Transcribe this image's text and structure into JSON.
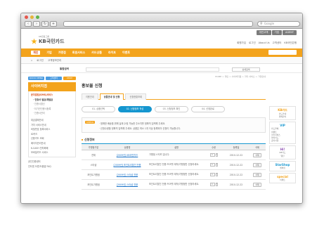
{
  "browser": {
    "search_placeholder": "Google"
  },
  "utility": [
    "개인고객",
    "기업",
    "AGENT"
  ],
  "logo": {
    "sub": "KB금융그룹",
    "name": "KB국민카드"
  },
  "toplinks": [
    "회원가입",
    "로그인",
    "About Us",
    "고객센터",
    "KB국민은행"
  ],
  "gnb": {
    "items": [
      "개인",
      "기업",
      "가맹점",
      "회원서비스",
      "카드상품",
      "라이프",
      "이벤트"
    ],
    "active_index": 0
  },
  "subnav": {
    "home_icon": "house-icon",
    "items": [
      "로그인",
      "고객정보관리"
    ]
  },
  "search_row": {
    "select": "통합검색",
    "button": "상세검색"
  },
  "quick": [
    "QUICK MENU",
    "고객센터",
    "CHAT"
  ],
  "lnb": {
    "title": "사이버지점",
    "items": [
      {
        "label": "문자알림(SMS)서비스",
        "level": 0,
        "on": true
      },
      {
        "label": "· 인증서 발급/재발급",
        "level": 1,
        "on": true
      },
      {
        "label": "· 인증서갱신",
        "level": 1,
        "on": false
      },
      {
        "label": "· 타기관인증서등록",
        "level": 1,
        "on": false
      },
      {
        "label": "· 인증서관리",
        "level": 1,
        "on": false
      },
      {
        "label": "",
        "level": -1,
        "on": false
      },
      {
        "label": "대금결제안내",
        "level": 0,
        "on": false
      },
      {
        "label": "가치 서비스안내",
        "level": 0,
        "on": false
      },
      {
        "label": "비밀번호 등록서비스",
        "level": 0,
        "on": false
      },
      {
        "label": "ID카드",
        "level": 0,
        "on": false
      },
      {
        "label": "신용카드 조회",
        "level": 0,
        "on": false
      },
      {
        "label": "페이지관리안내",
        "level": 0,
        "on": false
      },
      {
        "label": "K-CASH 전자화폐",
        "level": 0,
        "on": false
      },
      {
        "label": "모바일카드 서비스",
        "level": 0,
        "on": false
      }
    ],
    "footer": [
      "공인인증센터",
      "인터넷 오류/도움말 FAQ"
    ]
  },
  "breadcrumb": "HOME > 개인 > 사이버지점 > 기타 서비스 > 가입안내",
  "page_title": "홍보물 신청",
  "tabs": [
    "이용안내",
    "상품안내 및 신청",
    "신청현황조회"
  ],
  "active_tab": 1,
  "steps": [
    "01. 상품선택",
    "02. 신청정보 작성",
    "03. 신청정보 확인",
    "04. 신청완료"
  ],
  "active_step": 1,
  "notice": {
    "tag": "CHECK",
    "lines": [
      "· 정확한 배송을 위해 실제 수령 가능한 주소지를 정확히 입력해 주세요.",
      "· 신청수량을 정확히 입력해 주세요. 상품은 최소 1개 이상 등록되어 신청이 가능합니다."
    ]
  },
  "section_title": "신청정보",
  "table": {
    "headers": [
      "가맹점구분",
      "상품명",
      "설명",
      "수량",
      "등록일",
      "삭제"
    ],
    "rows": [
      {
        "category": "전체",
        "product": "[2009년] KB국민카드",
        "desc": "가맹점 스티커 입니다.",
        "qty": "1",
        "date": "2010-12-22",
        "del": "삭제"
      },
      {
        "category": "스타샵",
        "product": "[2009년] 포인트리할인 전용",
        "desc": "포인트리할인 전용 POP를 제작/가맹점만 신청하세요.",
        "qty": "1",
        "date": "2010-12-22",
        "del": "삭제"
      },
      {
        "category": "포인트가맹점",
        "product": "[2009년] 스타샵 전용",
        "desc": "포인트리할인 전용 POP를 제작/가맹점만 신청하세요.",
        "qty": "1",
        "date": "2010-12-22",
        "del": "삭제"
      },
      {
        "category": "포인트가맹점",
        "product": "[2009년] 스타샵 전용",
        "desc": "포인트리할인 전용 POP를 제작/가맹점만 신청하세요.",
        "qty": "1",
        "date": "2010-12-22",
        "del": "삭제"
      }
    ]
  },
  "right_banners": [
    {
      "title": "KB카드",
      "lines": [
        "카드안내",
        "결제관리"
      ],
      "color": "orange"
    },
    {
      "title": "VIP",
      "lines": [
        "카드연체",
        "이벤트",
        "할인서비스",
        "마이카드",
        "공지사항"
      ],
      "color": "blue"
    },
    {
      "title": "Hi!",
      "lines": [
        "KB카드",
        "웹진"
      ],
      "color": "purple"
    },
    {
      "title": "StarShop",
      "lines": [
        "멤버쉽"
      ],
      "color": "blue"
    },
    {
      "title": "special",
      "lines": [
        "이벤트"
      ],
      "color": "orange"
    }
  ]
}
